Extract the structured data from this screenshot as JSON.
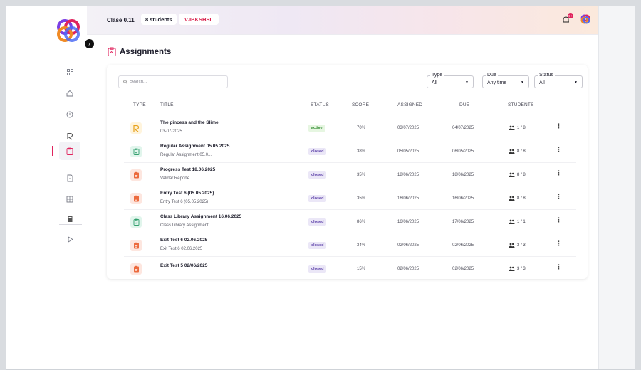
{
  "topbar": {
    "class_name": "Clase 0.11",
    "students_pill": "8 students",
    "class_code": "VJBKSHSL",
    "notification_badge": "9+"
  },
  "page": {
    "title": "Assignments"
  },
  "search": {
    "placeholder": "Search..."
  },
  "filters": [
    {
      "label": "Type",
      "value": "All"
    },
    {
      "label": "Due",
      "value": "Any time"
    },
    {
      "label": "Status",
      "value": "All"
    }
  ],
  "columns": [
    "TYPE",
    "TITLE",
    "STATUS",
    "SCORE",
    "ASSIGNED",
    "DUE",
    "STUDENTS"
  ],
  "rows": [
    {
      "type": "reading",
      "title": "The pincess and the Slime",
      "subtitle": "03-07-2025",
      "status": "active",
      "score": "70%",
      "assigned": "03/07/2025",
      "due": "04/07/2025",
      "students": "1 / 8"
    },
    {
      "type": "assignment",
      "title": "Regular Assignment 05.05.2025",
      "subtitle": "Regular Assignment 05.0...",
      "status": "closed",
      "score": "38%",
      "assigned": "05/05/2025",
      "due": "06/05/2025",
      "students": "8 / 8"
    },
    {
      "type": "test",
      "title": "Progress Test 18.06.2025",
      "subtitle": "Validar Reporte",
      "status": "closed",
      "score": "35%",
      "assigned": "18/06/2025",
      "due": "18/06/2025",
      "students": "8 / 8"
    },
    {
      "type": "test",
      "title": "Entry Test 6 (05.05.2025)",
      "subtitle": "Entry Test 6 (05.05.2025)",
      "status": "closed",
      "score": "35%",
      "assigned": "16/06/2025",
      "due": "16/06/2025",
      "students": "8 / 8"
    },
    {
      "type": "assignment",
      "title": "Class Library Assignment 16.06.2025",
      "subtitle": "Class Library Assignment ...",
      "status": "closed",
      "score": "86%",
      "assigned": "16/06/2025",
      "due": "17/06/2025",
      "students": "1 / 1"
    },
    {
      "type": "test",
      "title": "Exit Test 6 02.06.2025",
      "subtitle": "Exit Test 6 02.06.2025",
      "status": "closed",
      "score": "34%",
      "assigned": "02/06/2025",
      "due": "02/06/2025",
      "students": "3 / 3"
    },
    {
      "type": "test",
      "title": "Exit Test 5 02/06/2025",
      "subtitle": "",
      "status": "closed",
      "score": "15%",
      "assigned": "02/06/2025",
      "due": "02/06/2025",
      "students": "3 / 3"
    }
  ],
  "sidebar": {
    "items": [
      {
        "icon": "grid-icon"
      },
      {
        "icon": "home-icon"
      },
      {
        "icon": "clock-icon"
      },
      {
        "icon": "reading-icon"
      },
      {
        "icon": "assignments-icon"
      },
      {
        "icon": "document-icon"
      },
      {
        "icon": "report-icon"
      },
      {
        "icon": "book-icon"
      },
      {
        "icon": "play-icon"
      }
    ],
    "active_index": 4
  },
  "colors": {
    "accent": "#e0245e",
    "active_bg": "#e6f6e1",
    "active_fg": "#2e8a2e",
    "closed_bg": "#ebe7f7",
    "closed_fg": "#5b3fa8",
    "reading_bg": "#fff4dc",
    "reading_fg": "#e7a21b",
    "assignment_bg": "#e1f5ec",
    "assignment_fg": "#33a06f",
    "test_bg": "#fde6df",
    "test_fg": "#ec6a3d"
  }
}
